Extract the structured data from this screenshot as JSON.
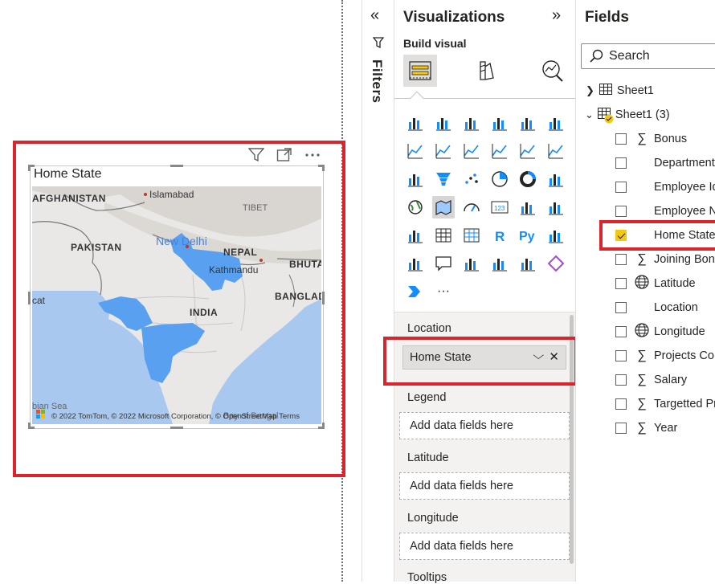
{
  "canvas": {
    "visual_title": "Home State",
    "map_labels": {
      "afghanistan": "AFGHANISTAN",
      "islamabad": "Islamabad",
      "tibet": "TIBET",
      "pakistan": "PAKISTAN",
      "new_delhi": "New Delhi",
      "nepal": "NEPAL",
      "kathmandu": "Kathmandu",
      "bhutan": "BHUTA",
      "muscat": "cat",
      "india": "INDIA",
      "bangladesh": "BANGLAD",
      "arabian_sea": "bian Sea",
      "bay_of_bengal": "Bay of Bengal"
    },
    "copyright": "© 2022 TomTom, © 2022 Microsoft Corporation, © OpenStreetMap  Terms",
    "highlight_color": "#d9252b",
    "map_fill_color": "#5aa0f0"
  },
  "filters": {
    "label": "Filters",
    "collapse_icon": "double-chevron-left-icon"
  },
  "visualizations": {
    "title": "Visualizations",
    "build_visual": "Build visual",
    "icons": [
      "stacked-bar-icon",
      "stacked-column-icon",
      "clustered-bar-icon",
      "clustered-column-icon",
      "100-bar-icon",
      "100-column-icon",
      "line-chart-icon",
      "area-chart-icon",
      "stacked-area-icon",
      "line-column-icon",
      "line-clustered-column-icon",
      "ribbon-chart-icon",
      "waterfall-icon",
      "funnel-icon",
      "scatter-icon",
      "pie-icon",
      "donut-icon",
      "treemap-icon",
      "map-icon",
      "filled-map-icon",
      "gauge-icon",
      "card-icon",
      "multi-row-card-icon",
      "kpi-icon",
      "slicer-icon",
      "table-icon",
      "matrix-icon",
      "r-visual-icon",
      "python-visual-icon",
      "key-influencers-icon",
      "decomposition-tree-icon",
      "qa-icon",
      "smart-narrative-icon",
      "paginated-report-icon",
      "azure-map-icon",
      "power-apps-icon",
      "power-automate-icon",
      "more-icon"
    ],
    "more_label": "···",
    "wells": {
      "location_label": "Location",
      "location_value": "Home State",
      "legend_label": "Legend",
      "latitude_label": "Latitude",
      "longitude_label": "Longitude",
      "tooltips_label": "Tooltips",
      "placeholder": "Add data fields here"
    }
  },
  "fields": {
    "title": "Fields",
    "search_placeholder": "Search",
    "tables": [
      {
        "name": "Sheet1",
        "expanded": false
      },
      {
        "name": "Sheet1 (3)",
        "expanded": true
      }
    ],
    "items": [
      {
        "label": "Bonus",
        "type": "sum",
        "checked": false
      },
      {
        "label": "Department",
        "type": "text",
        "checked": false
      },
      {
        "label": "Employee Id",
        "type": "text",
        "checked": false
      },
      {
        "label": "Employee N",
        "type": "text",
        "checked": false
      },
      {
        "label": "Home State",
        "type": "text",
        "checked": true
      },
      {
        "label": "Joining Bon",
        "type": "sum",
        "checked": false
      },
      {
        "label": "Latitude",
        "type": "globe",
        "checked": false
      },
      {
        "label": "Location",
        "type": "text",
        "checked": false
      },
      {
        "label": "Longitude",
        "type": "globe",
        "checked": false
      },
      {
        "label": "Projects Cor",
        "type": "sum",
        "checked": false
      },
      {
        "label": "Salary",
        "type": "sum",
        "checked": false
      },
      {
        "label": "Targetted Pr",
        "type": "sum",
        "checked": false
      },
      {
        "label": "Year",
        "type": "sum",
        "checked": false
      }
    ]
  }
}
